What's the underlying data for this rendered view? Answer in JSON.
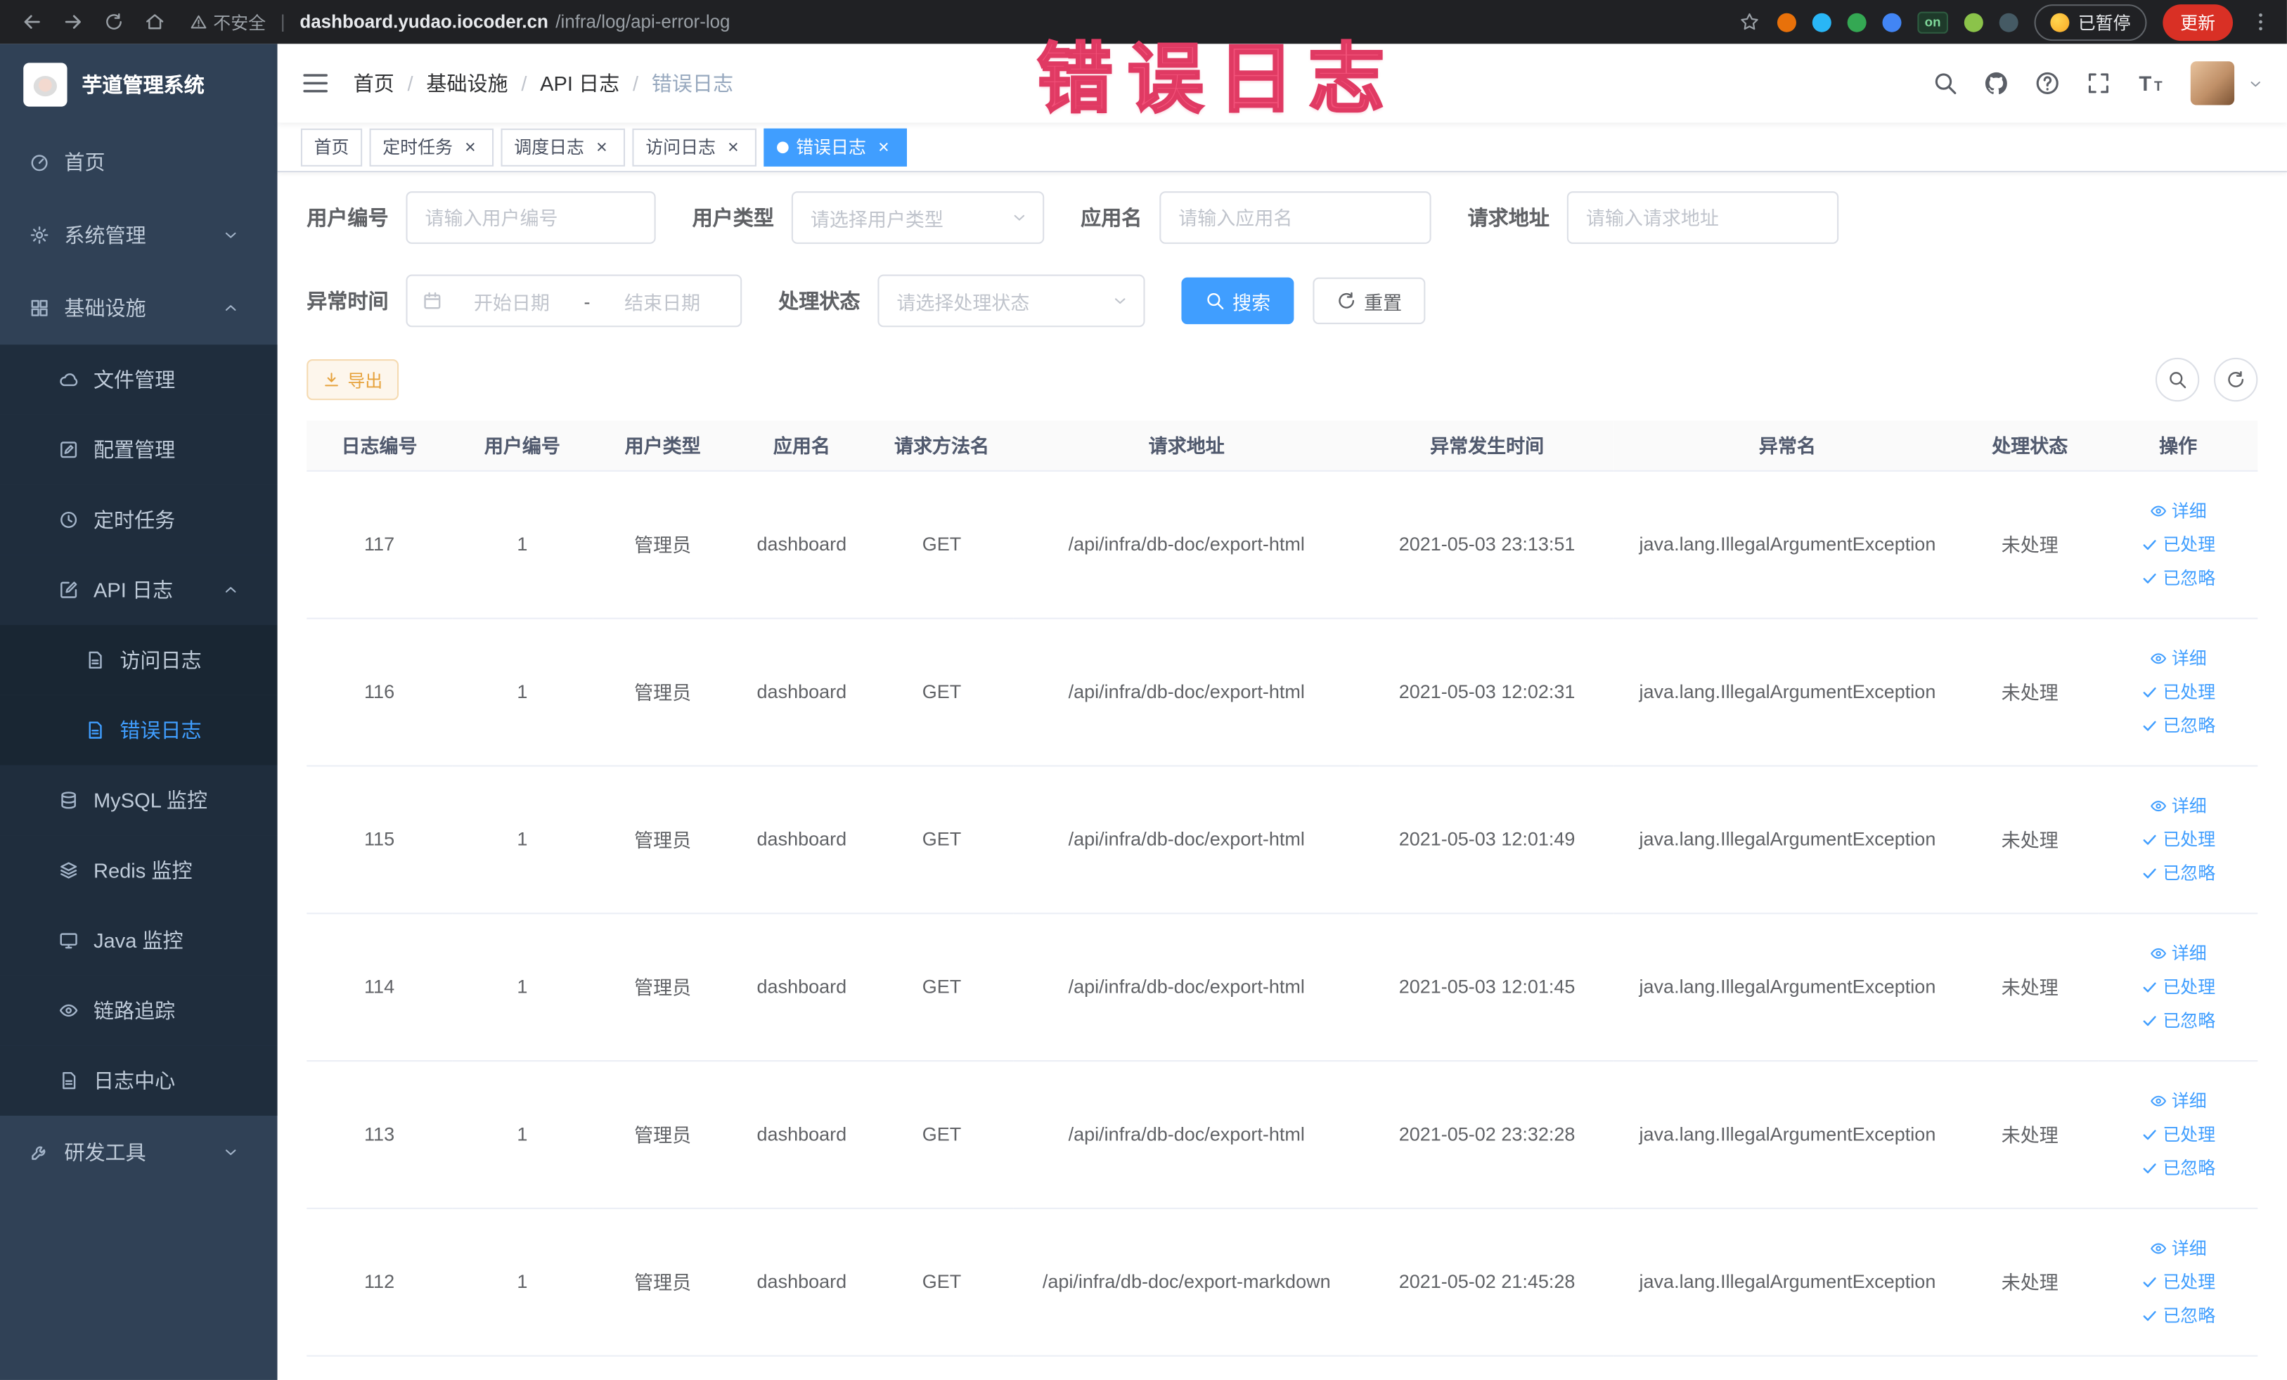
{
  "colors": {
    "accent": "#409eff",
    "sidebar_bg": "#304156",
    "submenu_bg": "#1f2d3d",
    "watermark": "#f2527a",
    "warning_text": "#e6a23c",
    "warning_bg": "#fdf6ec",
    "warning_border": "#f5dab1",
    "update_button_bg": "#d93025"
  },
  "watermark": "错误日志",
  "browser": {
    "security_label": "不安全",
    "url_host": "dashboard.yudao.iocoder.cn",
    "url_path": "/infra/log/api-error-log",
    "paused_label": "已暂停",
    "update_label": "更新",
    "nav_icons": [
      "back-icon",
      "forward-icon",
      "reload-icon",
      "home-icon"
    ],
    "extensions": [
      {
        "name": "bookmark-star-icon",
        "type": "star"
      },
      {
        "name": "extension-orange-icon",
        "type": "dot",
        "color": "#e8710a"
      },
      {
        "name": "extension-cyan-icon",
        "type": "dot",
        "color": "#29b6f6"
      },
      {
        "name": "extension-green-check-icon",
        "type": "dot",
        "color": "#34a853"
      },
      {
        "name": "extension-blue-grid-icon",
        "type": "dot",
        "color": "#4285f4"
      },
      {
        "name": "extension-on-badge",
        "type": "badge",
        "label": "on"
      },
      {
        "name": "extension-leaf-icon",
        "type": "dot",
        "color": "#8bc34a"
      },
      {
        "name": "extension-dark-icon",
        "type": "dot",
        "color": "#455a64"
      }
    ]
  },
  "sidebar": {
    "logo_title": "芋道管理系统",
    "items": [
      {
        "id": "home",
        "label": "首页",
        "level": 1,
        "icon": "dashboard-icon"
      },
      {
        "id": "system",
        "label": "系统管理",
        "level": 1,
        "icon": "gear-icon",
        "arrow": "down"
      },
      {
        "id": "infra",
        "label": "基础设施",
        "level": 1,
        "icon": "grid-icon",
        "arrow": "up"
      },
      {
        "id": "file",
        "label": "文件管理",
        "level": 2,
        "icon": "cloud-icon"
      },
      {
        "id": "config",
        "label": "配置管理",
        "level": 2,
        "icon": "edit-icon"
      },
      {
        "id": "job",
        "label": "定时任务",
        "level": 2,
        "icon": "clock-icon"
      },
      {
        "id": "api-log",
        "label": "API 日志",
        "level": 2,
        "icon": "compose-icon",
        "arrow": "up"
      },
      {
        "id": "access-log",
        "label": "访问日志",
        "level": 3,
        "icon": "doc-icon"
      },
      {
        "id": "error-log",
        "label": "错误日志",
        "level": 3,
        "icon": "doc-icon",
        "active": true
      },
      {
        "id": "mysql",
        "label": "MySQL 监控",
        "level": 2,
        "icon": "db-icon"
      },
      {
        "id": "redis",
        "label": "Redis 监控",
        "level": 2,
        "icon": "layers-icon"
      },
      {
        "id": "java",
        "label": "Java 监控",
        "level": 2,
        "icon": "monitor-icon"
      },
      {
        "id": "tracer",
        "label": "链路追踪",
        "level": 2,
        "icon": "eye-icon"
      },
      {
        "id": "log-center",
        "label": "日志中心",
        "level": 2,
        "icon": "doc-icon"
      },
      {
        "id": "dev-tools",
        "label": "研发工具",
        "level": 1,
        "icon": "tools-icon",
        "arrow": "down"
      }
    ]
  },
  "header": {
    "breadcrumb": [
      "首页",
      "基础设施",
      "API 日志",
      "错误日志"
    ],
    "right_icons": [
      "search-icon",
      "github-icon",
      "help-icon",
      "fullscreen-icon",
      "font-size-icon"
    ]
  },
  "tabs": [
    {
      "id": "home",
      "label": "首页",
      "closable": false,
      "active": false
    },
    {
      "id": "job",
      "label": "定时任务",
      "closable": true,
      "active": false
    },
    {
      "id": "job-log",
      "label": "调度日志",
      "closable": true,
      "active": false
    },
    {
      "id": "access-log",
      "label": "访问日志",
      "closable": true,
      "active": false
    },
    {
      "id": "error-log",
      "label": "错误日志",
      "closable": true,
      "active": true
    }
  ],
  "filters": {
    "user_id": {
      "label": "用户编号",
      "placeholder": "请输入用户编号"
    },
    "user_type": {
      "label": "用户类型",
      "placeholder": "请选择用户类型"
    },
    "app_name": {
      "label": "应用名",
      "placeholder": "请输入应用名"
    },
    "request_url": {
      "label": "请求地址",
      "placeholder": "请输入请求地址"
    },
    "error_time": {
      "label": "异常时间",
      "start_placeholder": "开始日期",
      "separator": "-",
      "end_placeholder": "结束日期"
    },
    "process_status": {
      "label": "处理状态",
      "placeholder": "请选择处理状态"
    },
    "search_label": "搜索",
    "reset_label": "重置"
  },
  "toolbar": {
    "export_label": "导出"
  },
  "table": {
    "columns": [
      "日志编号",
      "用户编号",
      "用户类型",
      "应用名",
      "请求方法名",
      "请求地址",
      "异常发生时间",
      "异常名",
      "处理状态",
      "操作"
    ],
    "row_actions": [
      {
        "id": "detail",
        "label": "详细",
        "icon": "eye-icon"
      },
      {
        "id": "processed",
        "label": "已处理",
        "icon": "check-icon"
      },
      {
        "id": "ignored",
        "label": "已忽略",
        "icon": "check-icon"
      }
    ],
    "rows": [
      {
        "log_id": "117",
        "user_id": "1",
        "user_type": "管理员",
        "app_name": "dashboard",
        "method": "GET",
        "request_url": "/api/infra/db-doc/export-html",
        "error_time": "2021-05-03 23:13:51",
        "exception_name": "java.lang.IllegalArgumentException",
        "process_status": "未处理"
      },
      {
        "log_id": "116",
        "user_id": "1",
        "user_type": "管理员",
        "app_name": "dashboard",
        "method": "GET",
        "request_url": "/api/infra/db-doc/export-html",
        "error_time": "2021-05-03 12:02:31",
        "exception_name": "java.lang.IllegalArgumentException",
        "process_status": "未处理"
      },
      {
        "log_id": "115",
        "user_id": "1",
        "user_type": "管理员",
        "app_name": "dashboard",
        "method": "GET",
        "request_url": "/api/infra/db-doc/export-html",
        "error_time": "2021-05-03 12:01:49",
        "exception_name": "java.lang.IllegalArgumentException",
        "process_status": "未处理"
      },
      {
        "log_id": "114",
        "user_id": "1",
        "user_type": "管理员",
        "app_name": "dashboard",
        "method": "GET",
        "request_url": "/api/infra/db-doc/export-html",
        "error_time": "2021-05-03 12:01:45",
        "exception_name": "java.lang.IllegalArgumentException",
        "process_status": "未处理"
      },
      {
        "log_id": "113",
        "user_id": "1",
        "user_type": "管理员",
        "app_name": "dashboard",
        "method": "GET",
        "request_url": "/api/infra/db-doc/export-html",
        "error_time": "2021-05-02 23:32:28",
        "exception_name": "java.lang.IllegalArgumentException",
        "process_status": "未处理"
      },
      {
        "log_id": "112",
        "user_id": "1",
        "user_type": "管理员",
        "app_name": "dashboard",
        "method": "GET",
        "request_url": "/api/infra/db-doc/export-markdown",
        "error_time": "2021-05-02 21:45:28",
        "exception_name": "java.lang.IllegalArgumentException",
        "process_status": "未处理"
      }
    ]
  }
}
